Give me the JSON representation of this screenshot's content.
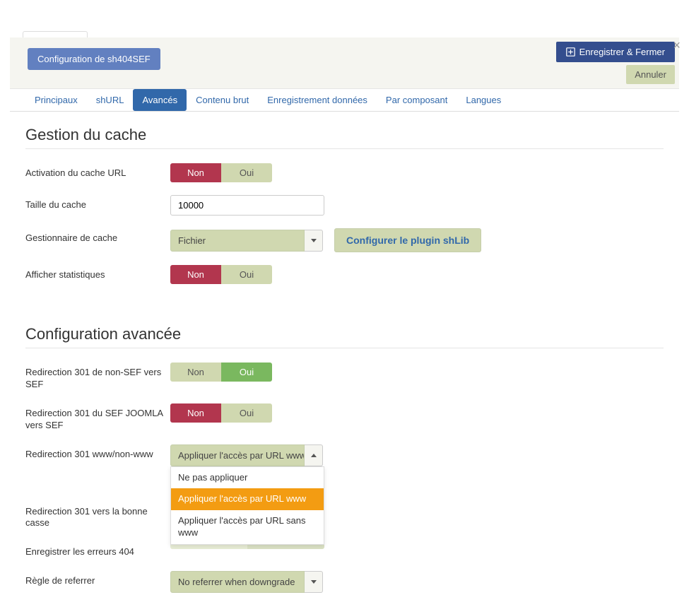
{
  "close_symbol": "×",
  "toolbar": {
    "config_label": "Configuration de sh404SEF",
    "save_label": "Enregistrer & Fermer",
    "cancel_label": "Annuler"
  },
  "tabs": [
    {
      "label": "Principaux"
    },
    {
      "label": "shURL"
    },
    {
      "label": "Avancés"
    },
    {
      "label": "Contenu brut"
    },
    {
      "label": "Enregistrement données"
    },
    {
      "label": "Par composant"
    },
    {
      "label": "Langues"
    }
  ],
  "active_tab_index": 2,
  "toggle_labels": {
    "non": "Non",
    "oui": "Oui"
  },
  "section_cache": {
    "title": "Gestion du cache",
    "fields": {
      "activation": {
        "label": "Activation du cache URL",
        "value": "Non"
      },
      "taille": {
        "label": "Taille du cache",
        "value": "10000"
      },
      "gestionnaire": {
        "label": "Gestionnaire de cache",
        "value": "Fichier",
        "button": "Configurer le plugin shLib"
      },
      "stats": {
        "label": "Afficher statistiques",
        "value": "Non"
      }
    }
  },
  "section_advanced": {
    "title": "Configuration avancée",
    "fields": {
      "redir_nonsef": {
        "label": "Redirection 301 de non-SEF vers SEF",
        "value": "Oui"
      },
      "redir_joomla": {
        "label": "Redirection 301 du SEF JOOMLA vers SEF",
        "value": "Non"
      },
      "redir_www": {
        "label": "Redirection 301 www/non-www",
        "value": "Appliquer l'accès par URL www",
        "options": [
          "Ne pas appliquer",
          "Appliquer l'accès par URL www",
          "Appliquer l'accès par URL sans www"
        ],
        "selected_index": 1
      },
      "redir_casse": {
        "label": "Redirection 301 vers la bonne casse"
      },
      "errors404": {
        "label": "Enregistrer les erreurs 404"
      },
      "referrer": {
        "label": "Règle de referrer",
        "value": "No referrer when downgrade"
      }
    }
  }
}
